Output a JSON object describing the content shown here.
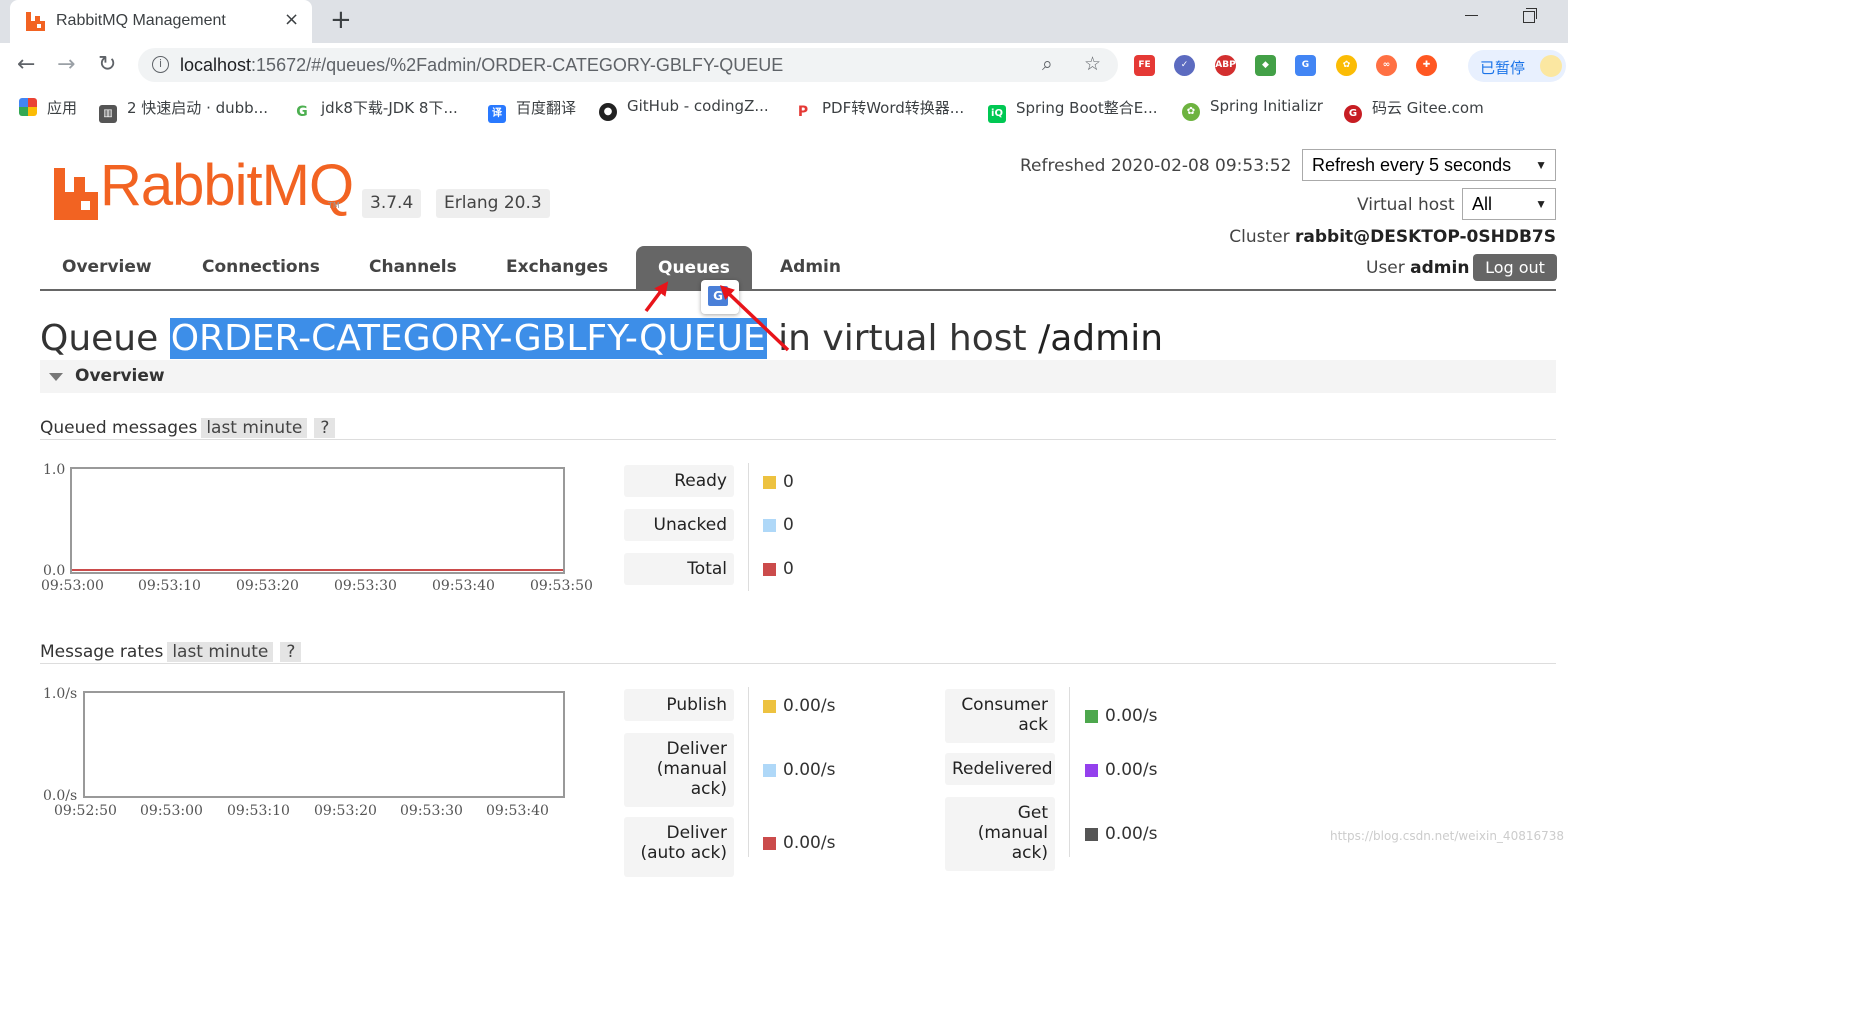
{
  "browser": {
    "tab_title": "RabbitMQ Management",
    "tab_close": "×",
    "new_tab": "+",
    "url_host": "localhost",
    "url_path": ":15672/#/queues/%2Fadmin/ORDER-CATEGORY-GBLFY-QUEUE",
    "paused_label": "已暂停",
    "bookmarks": [
      {
        "icon": "apps-grid-icon",
        "label": "应用"
      },
      {
        "icon": "book-icon",
        "label": "2 快速启动 · dubb..."
      },
      {
        "icon": "jdk-icon",
        "label": "jdk8下载-JDK 8下..."
      },
      {
        "icon": "translate-icon",
        "label": "百度翻译"
      },
      {
        "icon": "github-icon",
        "label": "GitHub - codingZ..."
      },
      {
        "icon": "pdf-icon",
        "label": "PDF转Word转换器..."
      },
      {
        "icon": "iqiyi-icon",
        "label": "Spring Boot整合E..."
      },
      {
        "icon": "spring-icon",
        "label": "Spring Initializr"
      },
      {
        "icon": "gitee-icon",
        "label": "码云 Gitee.com"
      }
    ]
  },
  "header": {
    "logo_text": "RabbitMQ",
    "logo_tm": "TM",
    "version": "3.7.4",
    "erlang": "Erlang 20.3",
    "refreshed": "Refreshed 2020-02-08 09:53:52",
    "refresh_select": "Refresh every 5 seconds",
    "vhost_label": "Virtual host",
    "vhost_select": "All",
    "cluster_label": "Cluster",
    "cluster_name": "rabbit@DESKTOP-0SHDB7S",
    "user_label": "User",
    "user_name": "admin",
    "logout": "Log out"
  },
  "nav": {
    "items": [
      "Overview",
      "Connections",
      "Channels",
      "Exchanges",
      "Queues",
      "Admin"
    ],
    "active": "Queues"
  },
  "page": {
    "title_prefix": "Queue",
    "queue_name": "ORDER-CATEGORY-GBLFY-QUEUE",
    "title_middle": "in virtual host",
    "vhost": "/admin",
    "section_title": "Overview"
  },
  "queued_messages": {
    "label": "Queued messages",
    "range": "last minute",
    "help": "?",
    "y_top": "1.0",
    "y_bottom": "0.0",
    "x_ticks": [
      "09:53:00",
      "09:53:10",
      "09:53:20",
      "09:53:30",
      "09:53:40",
      "09:53:50"
    ],
    "legend": [
      {
        "label": "Ready",
        "value": "0",
        "color": "#edc240"
      },
      {
        "label": "Unacked",
        "value": "0",
        "color": "#afd8f8"
      },
      {
        "label": "Total",
        "value": "0",
        "color": "#cb4b4b"
      }
    ]
  },
  "message_rates": {
    "label": "Message rates",
    "range": "last minute",
    "help": "?",
    "y_top": "1.0/s",
    "y_bottom": "0.0/s",
    "x_ticks": [
      "09:52:50",
      "09:53:00",
      "09:53:10",
      "09:53:20",
      "09:53:30",
      "09:53:40"
    ],
    "legend_left": [
      {
        "label": "Publish",
        "value": "0.00/s",
        "color": "#edc240"
      },
      {
        "label": "Deliver (manual ack)",
        "value": "0.00/s",
        "color": "#afd8f8"
      },
      {
        "label": "Deliver (auto ack)",
        "value": "0.00/s",
        "color": "#cb4b4b"
      }
    ],
    "legend_right": [
      {
        "label": "Consumer ack",
        "value": "0.00/s",
        "color": "#4da74d"
      },
      {
        "label": "Redelivered",
        "value": "0.00/s",
        "color": "#9440ed"
      },
      {
        "label": "Get (manual ack)",
        "value": "0.00/s",
        "color": "#555555"
      }
    ]
  },
  "watermark": "https://blog.csdn.net/weixin_40816738"
}
